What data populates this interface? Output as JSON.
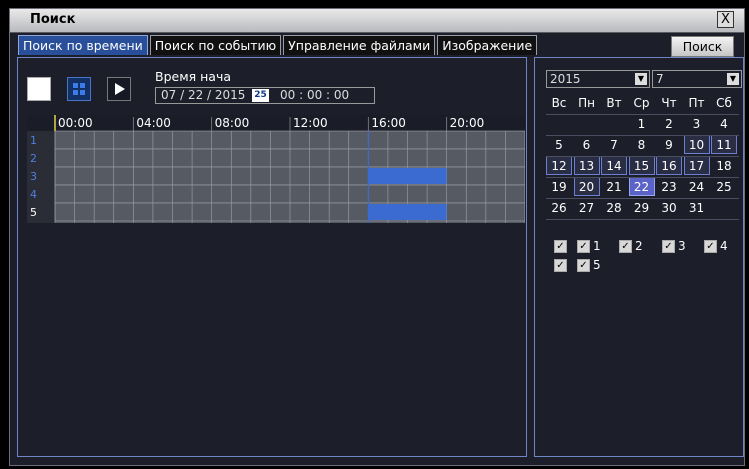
{
  "window": {
    "title": "Поиск",
    "close": "X"
  },
  "tabs": [
    {
      "label": "Поиск по времени",
      "active": true
    },
    {
      "label": "Поиск по событию"
    },
    {
      "label": "Управление файлами"
    },
    {
      "label": "Изображение"
    }
  ],
  "search_button": "Поиск",
  "start_time": {
    "label": "Время нача",
    "date": "07 / 22 / 2015",
    "calendar_icon_text": "25",
    "time": "00 : 00 : 00"
  },
  "timeline": {
    "hours": [
      "00:00",
      "04:00",
      "08:00",
      "12:00",
      "16:00",
      "20:00"
    ],
    "channels": [
      "1",
      "2",
      "3",
      "4",
      "5"
    ],
    "recordings": [
      {
        "channel": "3",
        "start": "16:00",
        "end": "20:00"
      },
      {
        "channel": "5",
        "start": "16:00",
        "end": "20:00"
      }
    ]
  },
  "calendar": {
    "year": "2015",
    "month": "7",
    "weekdays": [
      "Вс",
      "Пн",
      "Вт",
      "Ср",
      "Чт",
      "Пт",
      "Сб"
    ],
    "weeks": [
      [
        "",
        "",
        "",
        "1",
        "2",
        "3",
        "4"
      ],
      [
        "5",
        "6",
        "7",
        "8",
        "9",
        "10",
        "11"
      ],
      [
        "12",
        "13",
        "14",
        "15",
        "16",
        "17",
        "18"
      ],
      [
        "19",
        "20",
        "21",
        "22",
        "23",
        "24",
        "25"
      ],
      [
        "26",
        "27",
        "28",
        "29",
        "30",
        "31",
        ""
      ]
    ],
    "days_with_records": [
      "10",
      "11",
      "12",
      "13",
      "14",
      "15",
      "16",
      "17",
      "20"
    ],
    "selected_day": "22"
  },
  "channel_checks": [
    "1",
    "2",
    "3",
    "4",
    "5"
  ],
  "colors": {
    "accent": "#2a4f9a",
    "record_bar": "#3b6ad0",
    "panel_border": "#6f86c6"
  }
}
